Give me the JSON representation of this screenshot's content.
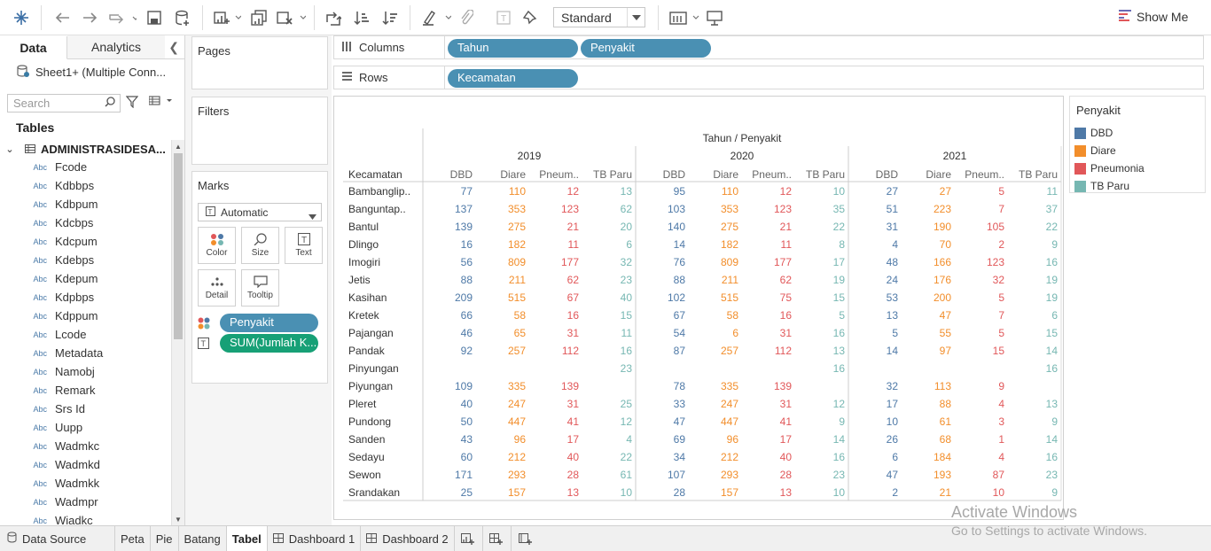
{
  "toolbar": {
    "standard_select": "Standard",
    "show_me": "Show Me"
  },
  "left_pane": {
    "tab_data": "Data",
    "tab_analytics": "Analytics",
    "connection": "Sheet1+ (Multiple Conn...",
    "search_placeholder": "Search",
    "tables_heading": "Tables",
    "table_name": "ADMINISTRASIDESA...",
    "field_type": "Abc",
    "fields": [
      "Fcode",
      "Kdbbps",
      "Kdbpum",
      "Kdcbps",
      "Kdcpum",
      "Kdebps",
      "Kdepum",
      "Kdpbps",
      "Kdppum",
      "Lcode",
      "Metadata",
      "Namobj",
      "Remark",
      "Srs Id",
      "Uupp",
      "Wadmkc",
      "Wadmkd",
      "Wadmkk",
      "Wadmpr",
      "Wiadkc"
    ]
  },
  "cards": {
    "pages": "Pages",
    "filters": "Filters",
    "marks": "Marks",
    "mark_type": "Automatic",
    "mark_buttons": [
      "Color",
      "Size",
      "Text",
      "Detail",
      "Tooltip"
    ],
    "pill_color": "Penyakit",
    "pill_text": "SUM(Jumlah K..."
  },
  "shelves": {
    "columns_label": "Columns",
    "rows_label": "Rows",
    "columns": [
      "Tahun",
      "Penyakit"
    ],
    "rows": [
      "Kecamatan"
    ]
  },
  "crosstab": {
    "header_title": "Tahun / Penyakit",
    "row_header": "Kecamatan",
    "years": [
      "2019",
      "2020",
      "2021"
    ],
    "diseases": [
      "DBD",
      "Diare",
      "Pneum..",
      "TB Paru"
    ],
    "rows": [
      {
        "name": "Bambanglip..",
        "v": [
          [
            77,
            110,
            12,
            13
          ],
          [
            95,
            110,
            12,
            10
          ],
          [
            27,
            27,
            5,
            11
          ]
        ]
      },
      {
        "name": "Banguntap..",
        "v": [
          [
            137,
            353,
            123,
            62
          ],
          [
            103,
            353,
            123,
            35
          ],
          [
            51,
            223,
            7,
            37
          ]
        ]
      },
      {
        "name": "Bantul",
        "v": [
          [
            139,
            275,
            21,
            20
          ],
          [
            140,
            275,
            21,
            22
          ],
          [
            31,
            190,
            105,
            22
          ]
        ]
      },
      {
        "name": "Dlingo",
        "v": [
          [
            16,
            182,
            11,
            6
          ],
          [
            14,
            182,
            11,
            8
          ],
          [
            4,
            70,
            2,
            9
          ]
        ]
      },
      {
        "name": "Imogiri",
        "v": [
          [
            56,
            809,
            177,
            32
          ],
          [
            76,
            809,
            177,
            17
          ],
          [
            48,
            166,
            123,
            16
          ]
        ]
      },
      {
        "name": "Jetis",
        "v": [
          [
            88,
            211,
            62,
            23
          ],
          [
            88,
            211,
            62,
            19
          ],
          [
            24,
            176,
            32,
            19
          ]
        ]
      },
      {
        "name": "Kasihan",
        "v": [
          [
            209,
            515,
            67,
            40
          ],
          [
            102,
            515,
            75,
            15
          ],
          [
            53,
            200,
            5,
            19
          ]
        ]
      },
      {
        "name": "Kretek",
        "v": [
          [
            66,
            58,
            16,
            15
          ],
          [
            67,
            58,
            16,
            5
          ],
          [
            13,
            47,
            7,
            6
          ]
        ]
      },
      {
        "name": "Pajangan",
        "v": [
          [
            46,
            65,
            31,
            11
          ],
          [
            54,
            6,
            31,
            16
          ],
          [
            5,
            55,
            5,
            15
          ]
        ]
      },
      {
        "name": "Pandak",
        "v": [
          [
            92,
            257,
            112,
            16
          ],
          [
            87,
            257,
            112,
            13
          ],
          [
            14,
            97,
            15,
            14
          ]
        ]
      },
      {
        "name": "Pinyungan",
        "v": [
          [
            null,
            null,
            null,
            23
          ],
          [
            null,
            null,
            null,
            16
          ],
          [
            null,
            null,
            null,
            16
          ]
        ]
      },
      {
        "name": "Piyungan",
        "v": [
          [
            109,
            335,
            139,
            null
          ],
          [
            78,
            335,
            139,
            null
          ],
          [
            32,
            113,
            9,
            null
          ]
        ]
      },
      {
        "name": "Pleret",
        "v": [
          [
            40,
            247,
            31,
            25
          ],
          [
            33,
            247,
            31,
            12
          ],
          [
            17,
            88,
            4,
            13
          ]
        ]
      },
      {
        "name": "Pundong",
        "v": [
          [
            50,
            447,
            41,
            12
          ],
          [
            47,
            447,
            41,
            9
          ],
          [
            10,
            61,
            3,
            9
          ]
        ]
      },
      {
        "name": "Sanden",
        "v": [
          [
            43,
            96,
            17,
            4
          ],
          [
            69,
            96,
            17,
            14
          ],
          [
            26,
            68,
            1,
            14
          ]
        ]
      },
      {
        "name": "Sedayu",
        "v": [
          [
            60,
            212,
            40,
            22
          ],
          [
            34,
            212,
            40,
            16
          ],
          [
            6,
            184,
            4,
            16
          ]
        ]
      },
      {
        "name": "Sewon",
        "v": [
          [
            171,
            293,
            28,
            61
          ],
          [
            107,
            293,
            28,
            23
          ],
          [
            47,
            193,
            87,
            23
          ]
        ]
      },
      {
        "name": "Srandakan",
        "v": [
          [
            25,
            157,
            13,
            10
          ],
          [
            28,
            157,
            13,
            10
          ],
          [
            2,
            21,
            10,
            9
          ]
        ]
      }
    ]
  },
  "legend": {
    "title": "Penyakit",
    "items": [
      {
        "label": "DBD",
        "color": "#4e79a7"
      },
      {
        "label": "Diare",
        "color": "#f28e2b"
      },
      {
        "label": "Pneumonia",
        "color": "#e15759"
      },
      {
        "label": "TB Paru",
        "color": "#76b7b2"
      }
    ]
  },
  "sheet_tabs": {
    "data_source": "Data Source",
    "tabs": [
      "Peta",
      "Pie",
      "Batang",
      "Tabel",
      "Dashboard 1",
      "Dashboard 2"
    ],
    "active": "Tabel"
  },
  "watermark": {
    "line1": "Activate Windows",
    "line2": "Go to Settings to activate Windows."
  }
}
